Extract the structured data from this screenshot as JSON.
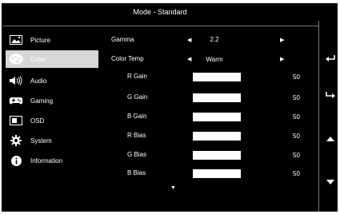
{
  "header": {
    "title": "Mode - Standard"
  },
  "sidebar": {
    "items": [
      {
        "label": "Picture",
        "icon": "picture-icon",
        "active": false
      },
      {
        "label": "Color",
        "icon": "palette-icon",
        "active": true
      },
      {
        "label": "Audio",
        "icon": "speaker-icon",
        "active": false
      },
      {
        "label": "Gaming",
        "icon": "gamepad-icon",
        "active": false
      },
      {
        "label": "OSD",
        "icon": "osd-icon",
        "active": false
      },
      {
        "label": "System",
        "icon": "gear-icon",
        "active": false
      },
      {
        "label": "Information",
        "icon": "info-icon",
        "active": false
      }
    ]
  },
  "settings": {
    "gamma": {
      "label": "Gamma",
      "value": "2.2"
    },
    "color_temp": {
      "label": "Color Temp",
      "value": "Warm"
    },
    "sliders": [
      {
        "label": "R Gain",
        "value": "50",
        "level": 0.5
      },
      {
        "label": "G Gain",
        "value": "50",
        "level": 0.5
      },
      {
        "label": "B Gain",
        "value": "50",
        "level": 0.5
      },
      {
        "label": "R Bias",
        "value": "50",
        "level": 0.5
      },
      {
        "label": "G Bias",
        "value": "50",
        "level": 0.5
      },
      {
        "label": "B Bias",
        "value": "50",
        "level": 0.5
      }
    ]
  },
  "nav_buttons": [
    {
      "name": "back-icon"
    },
    {
      "name": "enter-icon"
    },
    {
      "name": "up-icon"
    },
    {
      "name": "down-icon"
    }
  ],
  "colors": {
    "background": "#000000",
    "highlight": "#d7d7d7",
    "text": "#ffffff"
  }
}
